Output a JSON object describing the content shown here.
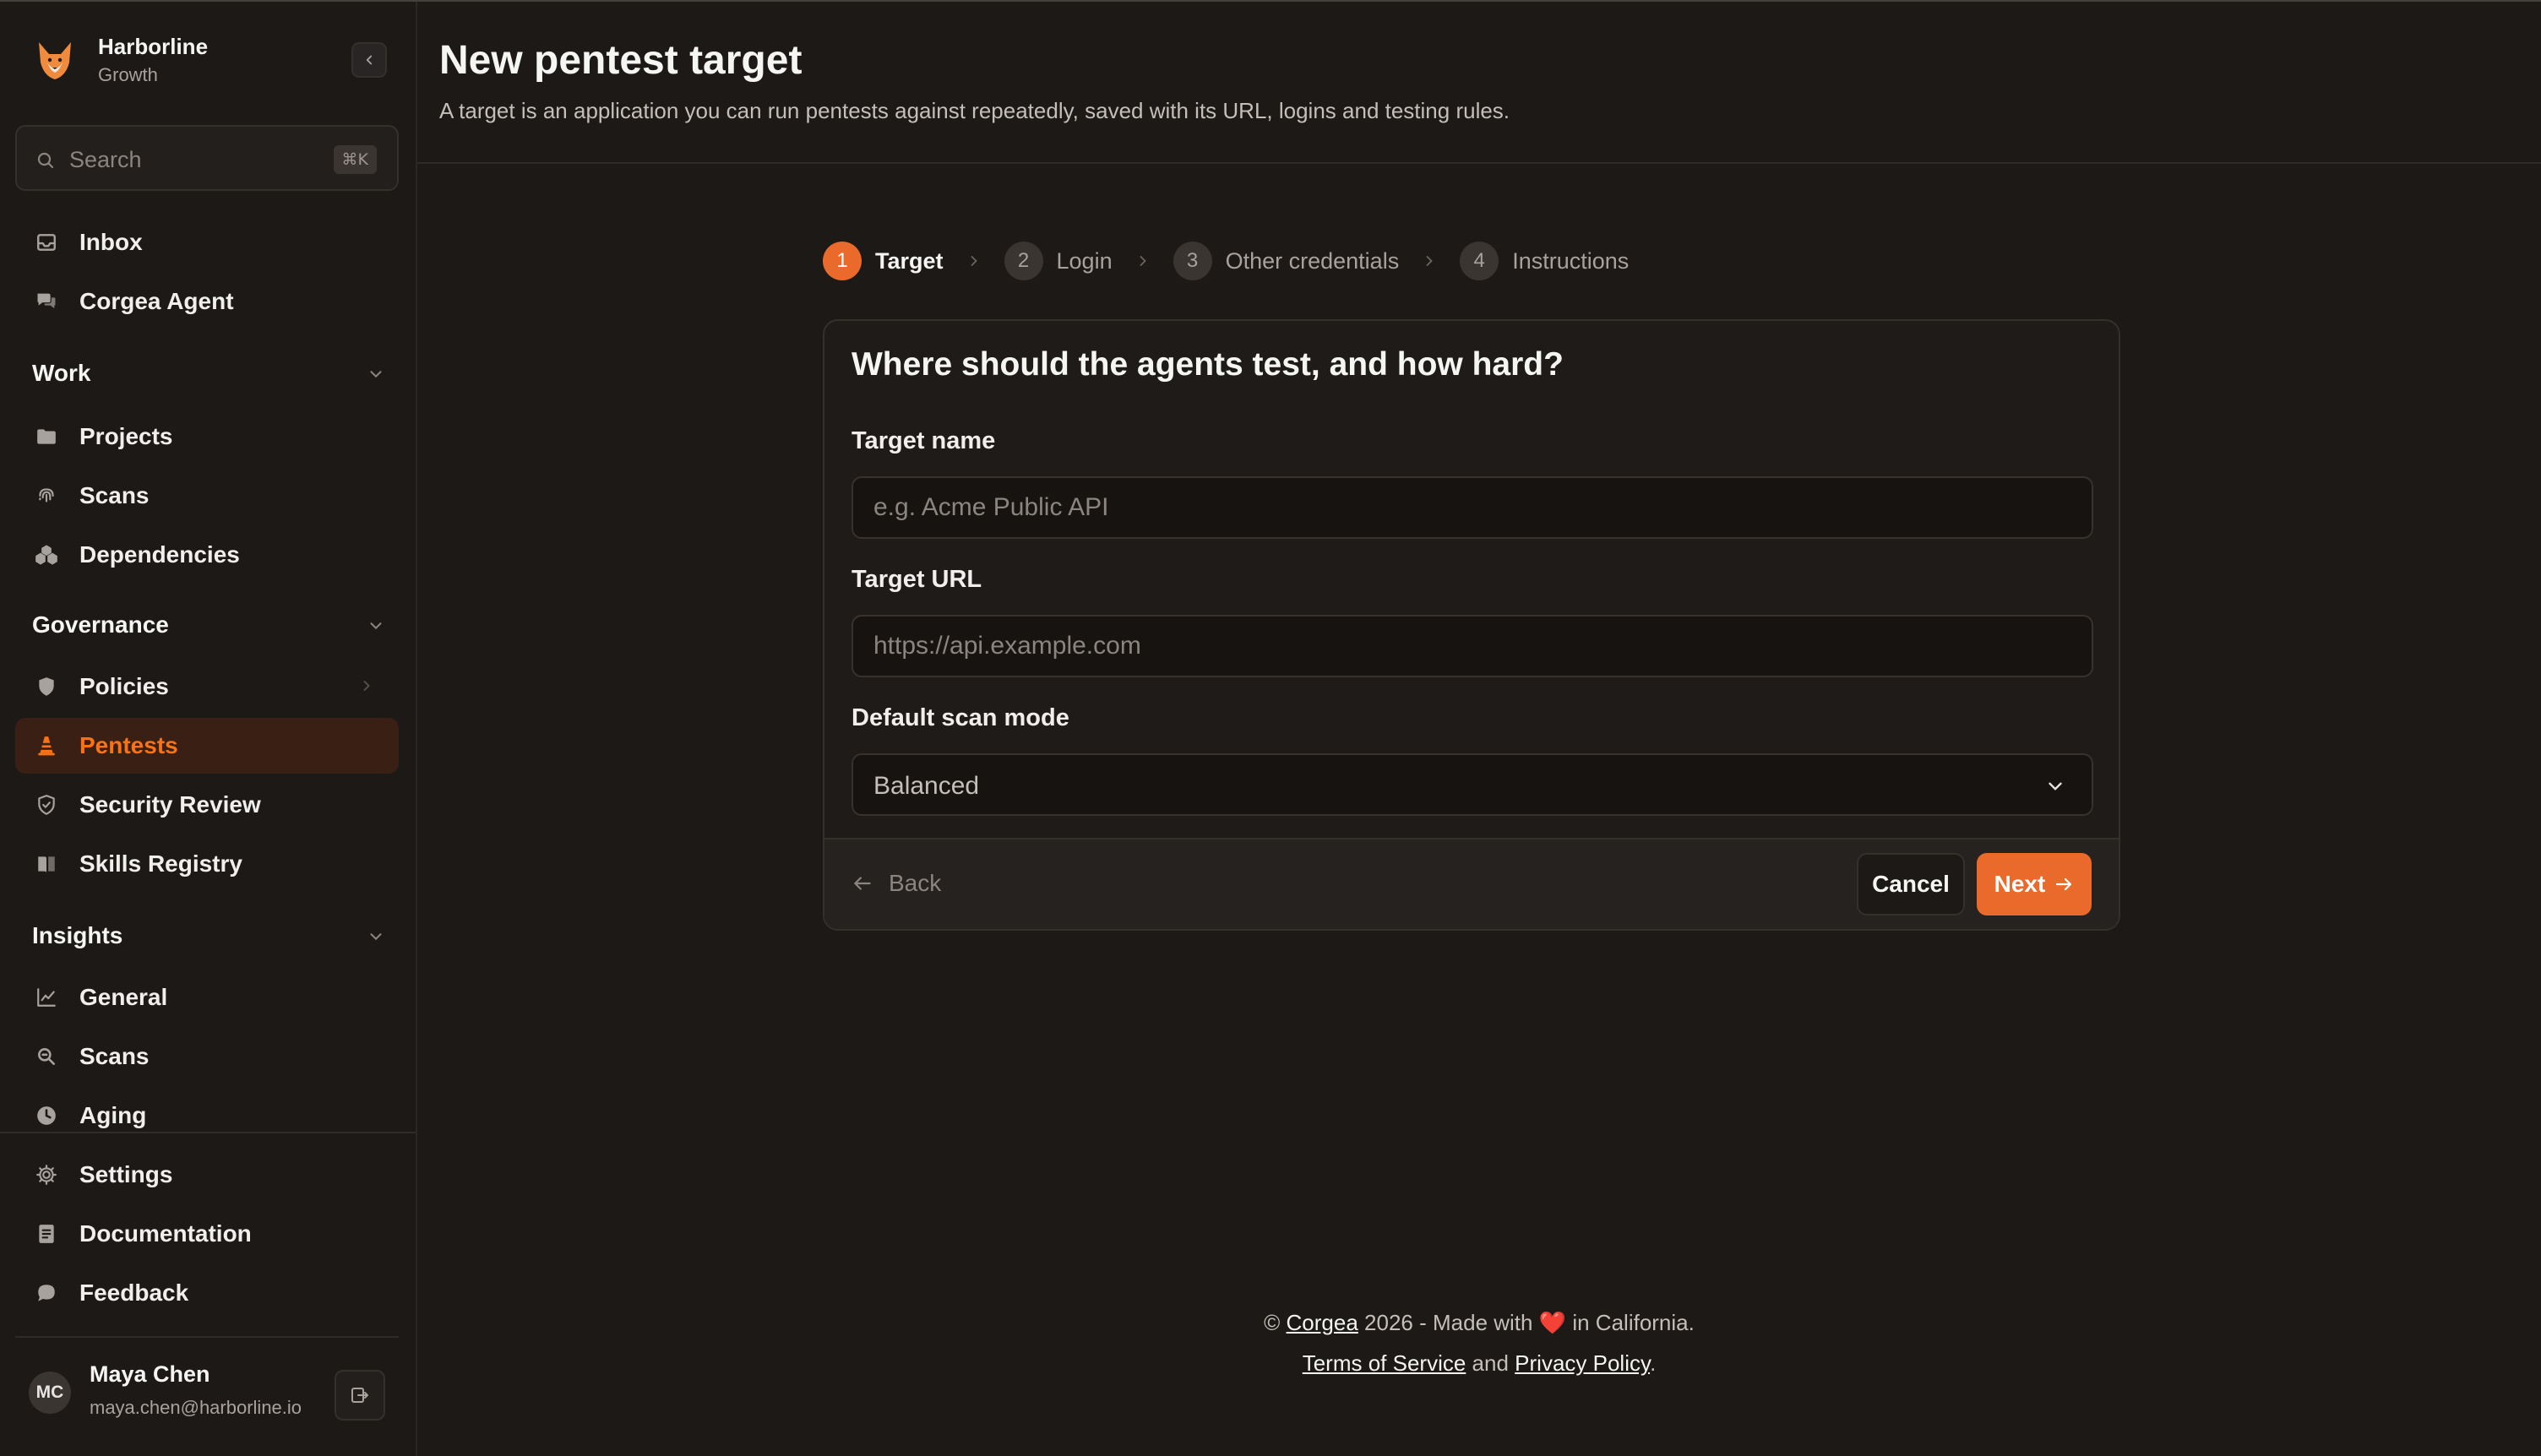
{
  "org": {
    "name": "Harborline",
    "plan": "Growth"
  },
  "search": {
    "placeholder": "Search",
    "shortcut": "⌘K"
  },
  "sidebar": {
    "top_items": [
      {
        "label": "Inbox",
        "icon": "inbox-icon"
      },
      {
        "label": "Corgea Agent",
        "icon": "chat-icon"
      }
    ],
    "sections": [
      {
        "title": "Work",
        "items": [
          {
            "label": "Projects",
            "icon": "folder-icon"
          },
          {
            "label": "Scans",
            "icon": "fingerprint-icon"
          },
          {
            "label": "Dependencies",
            "icon": "boxes-icon"
          }
        ]
      },
      {
        "title": "Governance",
        "items": [
          {
            "label": "Policies",
            "icon": "shield-icon"
          },
          {
            "label": "Pentests",
            "icon": "cone-icon",
            "active": true
          },
          {
            "label": "Security Review",
            "icon": "shield-check-icon"
          },
          {
            "label": "Skills Registry",
            "icon": "book-icon"
          }
        ]
      },
      {
        "title": "Insights",
        "items": [
          {
            "label": "General",
            "icon": "chart-icon"
          },
          {
            "label": "Scans",
            "icon": "scan-search-icon"
          },
          {
            "label": "Aging",
            "icon": "clock-icon"
          }
        ]
      }
    ],
    "bottom_items": [
      {
        "label": "Settings",
        "icon": "gear-icon"
      },
      {
        "label": "Documentation",
        "icon": "document-icon"
      },
      {
        "label": "Feedback",
        "icon": "message-icon"
      }
    ]
  },
  "user": {
    "initials": "MC",
    "name": "Maya Chen",
    "email": "maya.chen@harborline.io"
  },
  "page": {
    "title": "New pentest target",
    "subtitle": "A target is an application you can run pentests against repeatedly, saved with its URL, logins and testing rules."
  },
  "steps": [
    {
      "num": "1",
      "label": "Target",
      "active": true
    },
    {
      "num": "2",
      "label": "Login"
    },
    {
      "num": "3",
      "label": "Other credentials"
    },
    {
      "num": "4",
      "label": "Instructions"
    }
  ],
  "form": {
    "question": "Where should the agents test, and how hard?",
    "target_name": {
      "label": "Target name",
      "placeholder": "e.g. Acme Public API",
      "value": ""
    },
    "target_url": {
      "label": "Target URL",
      "placeholder": "https://api.example.com",
      "value": ""
    },
    "scan_mode": {
      "label": "Default scan mode",
      "value": "Balanced"
    },
    "back_label": "Back",
    "cancel_label": "Cancel",
    "next_label": "Next"
  },
  "footer": {
    "copyright_symbol": "©",
    "brand": "Corgea",
    "made_with_pre": "2026 - Made with",
    "heart": "❤️",
    "made_with_post": "in California.",
    "terms": "Terms of Service",
    "and": "and",
    "privacy": "Privacy Policy",
    "period": "."
  },
  "colors": {
    "accent": "#ea6a2c",
    "active_bg": "#3a1f14",
    "background": "#1c1917"
  }
}
